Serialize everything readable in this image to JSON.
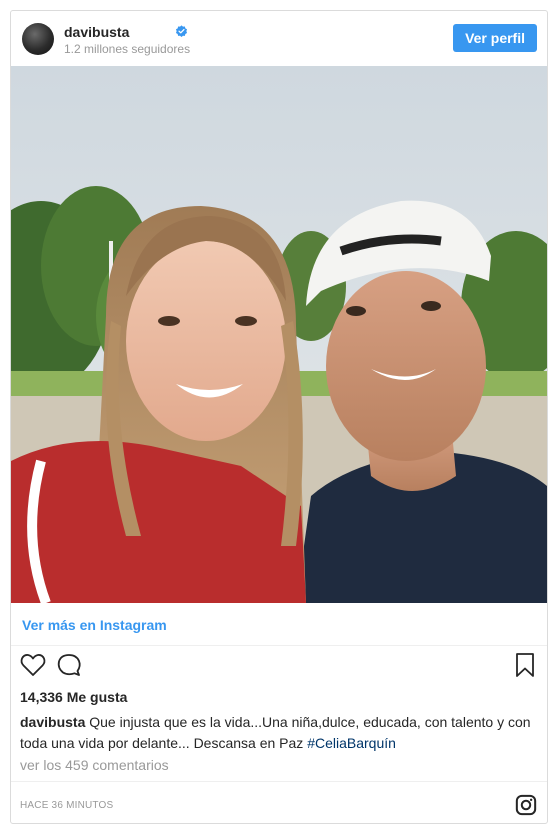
{
  "header": {
    "username": "davibusta",
    "followers": "1.2 millones seguidores",
    "view_profile_label": "Ver perfil"
  },
  "post": {
    "view_more_label": "Ver más en Instagram",
    "likes": "14,336 Me gusta",
    "caption_user": "davibusta",
    "caption_text": "Que injusta que es la vida...Una niña,dulce, educada, con talento y con toda una vida por delante... Descansa en Paz ",
    "caption_hashtag": "#CeliaBarquín",
    "comments_link": "ver los 459 comentarios",
    "time": "HACE 36 MINUTOS"
  },
  "icons": {
    "verified": "verified-badge-icon",
    "like": "heart-icon",
    "comment": "comment-bubble-icon",
    "save": "bookmark-icon",
    "brand": "instagram-logo-icon"
  },
  "colors": {
    "accent": "#3897f0",
    "hashtag": "#003569",
    "muted": "#999999",
    "border": "#dbdbdb"
  }
}
